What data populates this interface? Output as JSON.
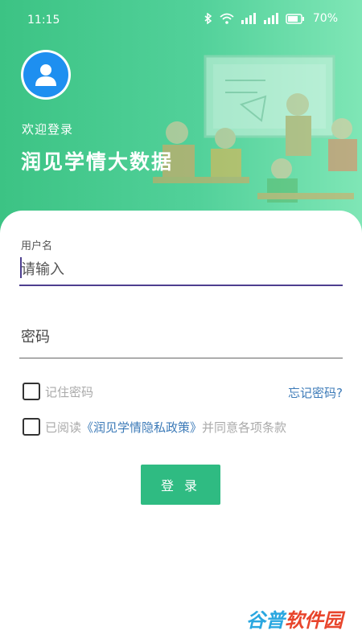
{
  "status_bar": {
    "time": "11:15",
    "battery": "70%"
  },
  "header": {
    "welcome": "欢迎登录",
    "app_title": "润见学情大数据"
  },
  "form": {
    "username_label": "用户名",
    "username_placeholder": "请输入",
    "password_placeholder": "密码",
    "remember_label": "记住密码",
    "forgot_link": "忘记密码?",
    "agree_prefix": "已阅读",
    "policy_link": "《润见学情隐私政策》",
    "agree_suffix": "并同意各项条款",
    "login_button": "登 录"
  },
  "watermark": {
    "part1": "谷普",
    "part2": "软件园"
  },
  "colors": {
    "header_start": "#3cc384",
    "header_end": "#7fe6b6",
    "button": "#2fbb82",
    "link": "#3d7bb8",
    "avatar": "#1e8ff0",
    "focus_underline": "#4d3f8f"
  }
}
